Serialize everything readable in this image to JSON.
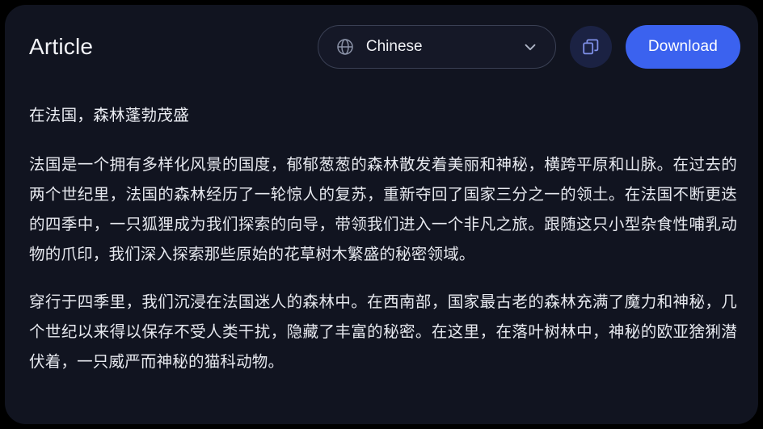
{
  "header": {
    "title": "Article",
    "language_select": {
      "icon": "globe-icon",
      "value": "Chinese",
      "chevron": "chevron-down-icon"
    },
    "copy_button": {
      "icon": "copy-icon"
    },
    "download_button": {
      "label": "Download"
    }
  },
  "colors": {
    "panel_background": "#111420",
    "outer_background": "#000000",
    "accent_blue": "#3b62ef",
    "copy_button_background": "#1b2243",
    "copy_icon_stroke": "#7f90e8",
    "select_border": "#3a4054",
    "text_primary": "#e7e9ef",
    "icon_muted": "#8b93a8"
  },
  "article": {
    "heading": "在法国，森林蓬勃茂盛",
    "paragraphs": [
      "法国是一个拥有多样化风景的国度，郁郁葱葱的森林散发着美丽和神秘，横跨平原和山脉。在过去的两个世纪里，法国的森林经历了一轮惊人的复苏，重新夺回了国家三分之一的领土。在法国不断更迭的四季中，一只狐狸成为我们探索的向导，带领我们进入一个非凡之旅。跟随这只小型杂食性哺乳动物的爪印，我们深入探索那些原始的花草树木繁盛的秘密领域。",
      "穿行于四季里，我们沉浸在法国迷人的森林中。在西南部，国家最古老的森林充满了魔力和神秘，几个世纪以来得以保存不受人类干扰，隐藏了丰富的秘密。在这里，在落叶树林中，神秘的欧亚猞猁潜伏着，一只威严而神秘的猫科动物。"
    ]
  }
}
